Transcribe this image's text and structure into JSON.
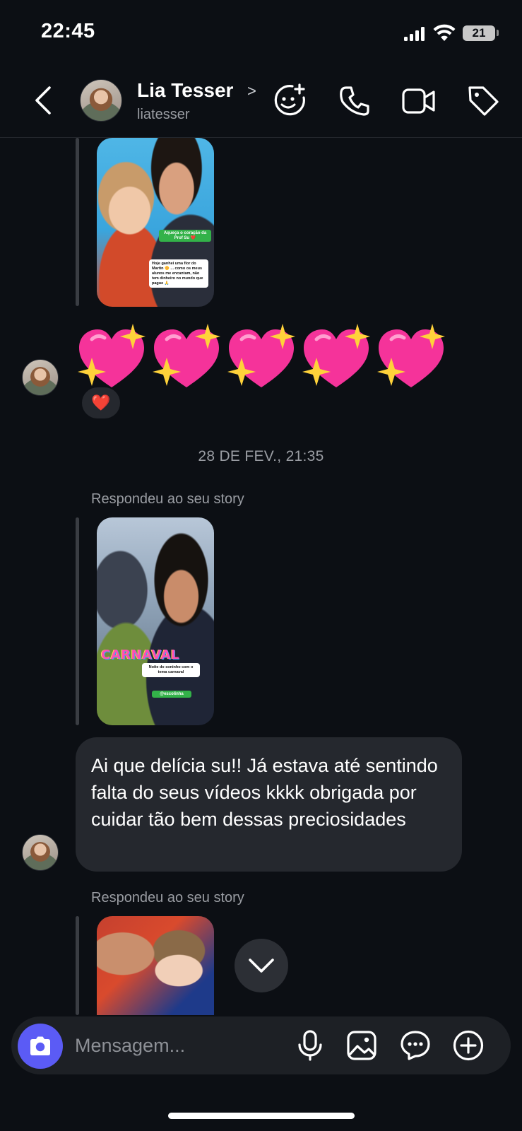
{
  "status_bar": {
    "time": "22:45",
    "battery": "21",
    "icons": [
      "signal-icon",
      "wifi-icon",
      "battery-icon"
    ]
  },
  "header": {
    "name": "Lia Tesser",
    "handle": "liatesser",
    "chevron": ">",
    "actions": [
      "sticker-add-icon",
      "phone-icon",
      "video-camera-icon",
      "tag-icon"
    ]
  },
  "story1": {
    "green_tag": "Aqueça o coração da Prof Su ❤️",
    "white_tag": "Hoje ganhei uma flor do Martin 🌼 ... como os meus alunos me encantam, não tem dinheiro no mundo que pague 🙏"
  },
  "emoji_message": {
    "emojis": [
      "💖",
      "💖",
      "💖",
      "💖",
      "💖"
    ],
    "reaction": "❤️"
  },
  "date_separator": "28 DE FEV., 21:35",
  "story2": {
    "label": "Respondeu ao seu story",
    "overlay_title": "CARNAVAL",
    "white_tag": "Noite do soninho com o tema carnaval",
    "green_tag": "@escolinha"
  },
  "message": {
    "text": "Ai que delícia su!! Já estava até sentindo falta do seus vídeos kkkk obrigada por cuidar tão bem dessas preciosidades"
  },
  "story3": {
    "label": "Respondeu ao seu story"
  },
  "composer": {
    "placeholder": "Mensagem...",
    "icons": [
      "camera-icon",
      "microphone-icon",
      "gallery-icon",
      "sticker-chat-icon",
      "add-icon"
    ]
  },
  "colors": {
    "background": "#0c0f14",
    "bubble": "#25282e",
    "accent": "#5b5bf5",
    "muted_text": "#9a9da3"
  }
}
